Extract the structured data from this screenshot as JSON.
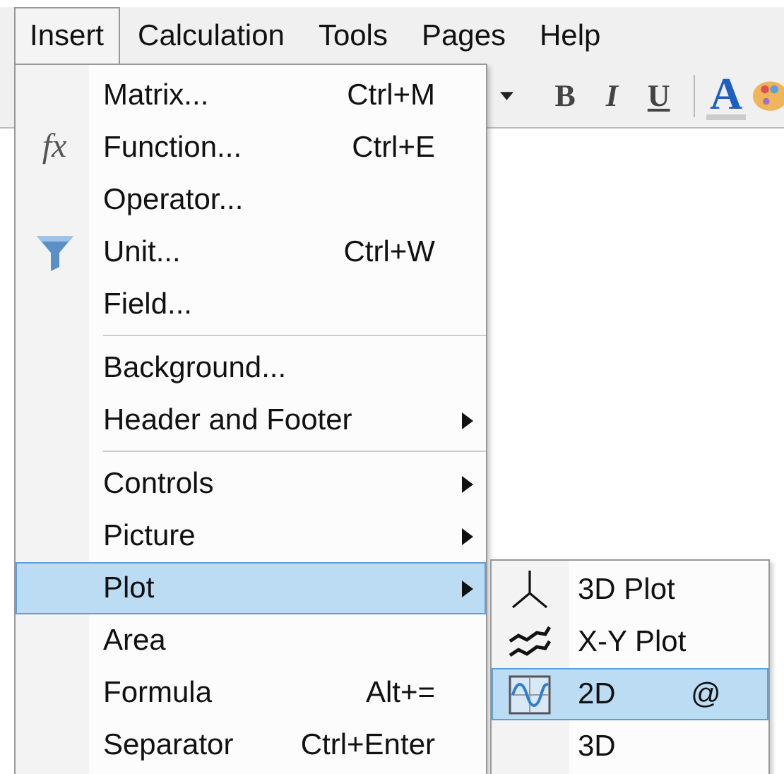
{
  "menubar": [
    {
      "label": "Insert",
      "selected": true
    },
    {
      "label": "Calculation",
      "selected": false
    },
    {
      "label": "Tools",
      "selected": false
    },
    {
      "label": "Pages",
      "selected": false
    },
    {
      "label": "Help",
      "selected": false
    }
  ],
  "toolbar": [
    {
      "kind": "caret"
    },
    {
      "kind": "bold",
      "label": "B"
    },
    {
      "kind": "italic",
      "label": "I"
    },
    {
      "kind": "underline",
      "label": "U"
    },
    {
      "kind": "separator"
    },
    {
      "kind": "color",
      "label": "A"
    },
    {
      "kind": "palette"
    }
  ],
  "menu": [
    {
      "kind": "item",
      "label": "Matrix...",
      "shortcut": "Ctrl+M",
      "submenu": false,
      "selected": false
    },
    {
      "kind": "item",
      "label": "Function...",
      "shortcut": "Ctrl+E",
      "submenu": false,
      "selected": false,
      "icon_text": "fx"
    },
    {
      "kind": "item",
      "label": "Operator...",
      "submenu": false,
      "selected": false
    },
    {
      "kind": "item",
      "label": "Unit...",
      "shortcut": "Ctrl+W",
      "submenu": false,
      "selected": false
    },
    {
      "kind": "item",
      "label": "Field...",
      "submenu": false,
      "selected": false
    },
    {
      "kind": "separator"
    },
    {
      "kind": "item",
      "label": "Background...",
      "submenu": false,
      "selected": false
    },
    {
      "kind": "item",
      "label": "Header and Footer",
      "submenu": true,
      "selected": false
    },
    {
      "kind": "separator"
    },
    {
      "kind": "item",
      "label": "Controls",
      "submenu": true,
      "selected": false
    },
    {
      "kind": "item",
      "label": "Picture",
      "submenu": true,
      "selected": false
    },
    {
      "kind": "item",
      "label": "Plot",
      "submenu": true,
      "selected": true
    },
    {
      "kind": "item",
      "label": "Area",
      "submenu": false,
      "selected": false
    },
    {
      "kind": "item",
      "label": "Formula",
      "shortcut": "Alt+=",
      "submenu": false,
      "selected": false
    },
    {
      "kind": "item",
      "label": "Separator",
      "shortcut": "Ctrl+Enter",
      "submenu": false,
      "selected": false
    }
  ],
  "submenu": [
    {
      "kind": "axes",
      "label": "3D Plot",
      "selected": false
    },
    {
      "kind": "lines",
      "label": "X-Y Plot",
      "selected": false
    },
    {
      "kind": "wave",
      "label": "2D",
      "shortcut": "@",
      "selected": true
    },
    {
      "kind": "plain",
      "label": "3D",
      "selected": false
    }
  ]
}
